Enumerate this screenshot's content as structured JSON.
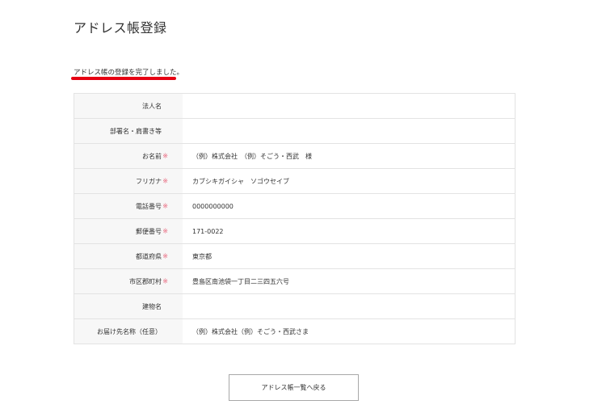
{
  "page": {
    "title": "アドレス帳登録",
    "message": "アドレス帳の登録を完了しました。"
  },
  "colors": {
    "accent": "#e60012",
    "required": "#e8637a",
    "label_bg": "#f7f7f7",
    "border": "#e3e3e3"
  },
  "table": {
    "rows": [
      {
        "label": "法人名",
        "required": false,
        "required_mark": "",
        "value": ""
      },
      {
        "label": "部署名・肩書き等",
        "required": false,
        "required_mark": "",
        "value": ""
      },
      {
        "label": "お名前",
        "required": true,
        "required_mark": "※",
        "value": "（例）株式会社　（例）そごう・西武　様"
      },
      {
        "label": "フリガナ",
        "required": true,
        "required_mark": "※",
        "value": "カブシキガイシャ　ソゴウセイブ"
      },
      {
        "label": "電話番号",
        "required": true,
        "required_mark": "※",
        "value": "0000000000"
      },
      {
        "label": "郵便番号",
        "required": true,
        "required_mark": "※",
        "value": "171-0022"
      },
      {
        "label": "都道府県",
        "required": true,
        "required_mark": "※",
        "value": "東京都"
      },
      {
        "label": "市区郡町村",
        "required": true,
        "required_mark": "※",
        "value": "豊島区南池袋一丁目二三四五六号"
      },
      {
        "label": "建物名",
        "required": false,
        "required_mark": "",
        "value": ""
      },
      {
        "label": "お届け先名称（任意）",
        "required": false,
        "required_mark": "",
        "value": "（例）株式会社（例）そごう・西武さま"
      }
    ]
  },
  "buttons": {
    "back_label": "アドレス帳一覧へ戻る"
  }
}
